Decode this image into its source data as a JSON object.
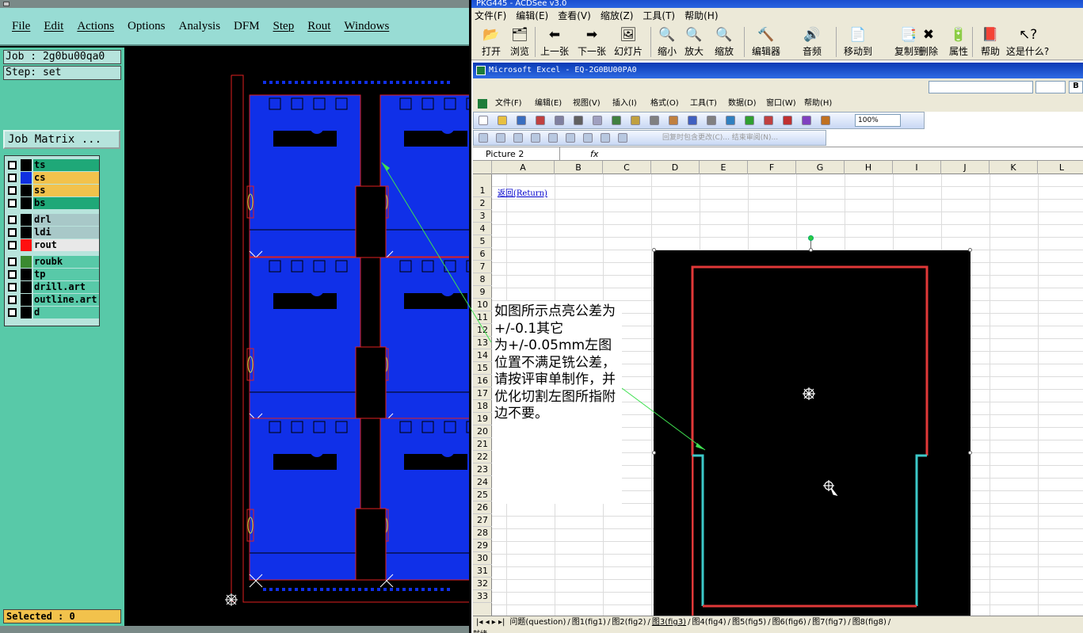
{
  "cam": {
    "menu": [
      "File",
      "Edit",
      "Actions",
      "Options",
      "Analysis",
      "DFM",
      "Step",
      "Rout",
      "Windows"
    ],
    "job_label": "Job : 2g0bu00qa0",
    "step_label": "Step: set",
    "job_matrix_button": "Job Matrix ...",
    "layers": [
      {
        "name": "ts",
        "color": "#1fa878",
        "swatch": "#000"
      },
      {
        "name": "cs",
        "color": "#f2c24c",
        "swatch": "#1030e0"
      },
      {
        "name": "ss",
        "color": "#f2c24c",
        "swatch": "#000"
      },
      {
        "name": "bs",
        "color": "#1fa878",
        "swatch": "#000"
      },
      {
        "name": "drl",
        "color": "#a8c8c8",
        "swatch": "#000"
      },
      {
        "name": "ldi",
        "color": "#a8c8c8",
        "swatch": "#000"
      },
      {
        "name": "rout",
        "color": "#e8e8e8",
        "swatch": "#ff1010"
      },
      {
        "name": "roubk",
        "color": "#58c9a8",
        "swatch": "#3a8a30"
      },
      {
        "name": "tp",
        "color": "#58c9a8",
        "swatch": "#000"
      },
      {
        "name": "drill.art",
        "color": "#58c9a8",
        "swatch": "#000"
      },
      {
        "name": "outline.art",
        "color": "#58c9a8",
        "swatch": "#000"
      },
      {
        "name": "d",
        "color": "#58c9a8",
        "swatch": "#000"
      }
    ],
    "selected_label": "Selected : 0"
  },
  "acdsee": {
    "title": "PKG445 - ACDSee v3.0",
    "menu": [
      "文件(F)",
      "编辑(E)",
      "查看(V)",
      "缩放(Z)",
      "工具(T)",
      "帮助(H)"
    ],
    "toolbar": [
      {
        "label": "打开",
        "icon": "open-folder-icon",
        "glyph": "📂"
      },
      {
        "label": "浏览",
        "icon": "browse-icon",
        "glyph": "🗂"
      },
      {
        "label": "上一张",
        "icon": "previous-icon",
        "glyph": "⬅"
      },
      {
        "label": "下一张",
        "icon": "next-icon",
        "glyph": "➡"
      },
      {
        "label": "幻灯片",
        "icon": "slideshow-icon",
        "glyph": "🖼"
      },
      {
        "label": "缩小",
        "icon": "zoom-out-icon",
        "glyph": "🔍"
      },
      {
        "label": "放大",
        "icon": "zoom-in-icon",
        "glyph": "🔍"
      },
      {
        "label": "缩放",
        "icon": "zoom-icon",
        "glyph": "🔍"
      },
      {
        "label": "编辑器",
        "icon": "editor-icon",
        "glyph": "🔨"
      },
      {
        "label": "音频",
        "icon": "audio-icon",
        "glyph": "🔊"
      },
      {
        "label": "移动到",
        "icon": "move-to-icon",
        "glyph": "📄"
      },
      {
        "label": "复制到",
        "icon": "copy-to-icon",
        "glyph": "📑"
      },
      {
        "label": "删除",
        "icon": "delete-icon",
        "glyph": "✖"
      },
      {
        "label": "属性",
        "icon": "properties-icon",
        "glyph": "🔋"
      },
      {
        "label": "帮助",
        "icon": "help-book-icon",
        "glyph": "📕"
      },
      {
        "label": "这是什么?",
        "icon": "whats-this-icon",
        "glyph": "↖?"
      }
    ]
  },
  "excel": {
    "title": "Microsoft Excel - EQ-2G0BU00PA0",
    "menu": [
      "文件(F)",
      "编辑(E)",
      "视图(V)",
      "插入(I)",
      "格式(O)",
      "工具(T)",
      "数据(D)",
      "窗口(W)",
      "帮助(H)"
    ],
    "zoom": "100%",
    "review_text": "回复时包含更改(C)...  结束审阅(N)...",
    "name_box": "Picture 2",
    "fx": "fx",
    "columns": [
      "A",
      "B",
      "C",
      "D",
      "E",
      "F",
      "G",
      "H",
      "I",
      "J",
      "K",
      "L"
    ],
    "rows": [
      "1",
      "2",
      "3",
      "4",
      "5",
      "6",
      "7",
      "8",
      "9",
      "10",
      "11",
      "12",
      "13",
      "14",
      "15",
      "16",
      "17",
      "18",
      "19",
      "20",
      "21",
      "22",
      "23",
      "24",
      "25",
      "26",
      "27",
      "28",
      "29",
      "30",
      "31",
      "32",
      "33"
    ],
    "return_link": "返回(Return)",
    "sheet_tabs": [
      "问题(question)",
      "图1(fig1)",
      "图2(fig2)",
      "图3(fig3)",
      "图4(fig4)",
      "图5(fig5)",
      "图6(fig6)",
      "图7(fig7)",
      "图8(fig8)"
    ],
    "active_tab": "图3(fig3)",
    "status": "就绪"
  },
  "note": "如图所示点亮公差为+/-0.1其它\n为+/-0.05mm左图位置不满足铣公差，请按评审单制作，并优化切割左图所指附边不要。"
}
